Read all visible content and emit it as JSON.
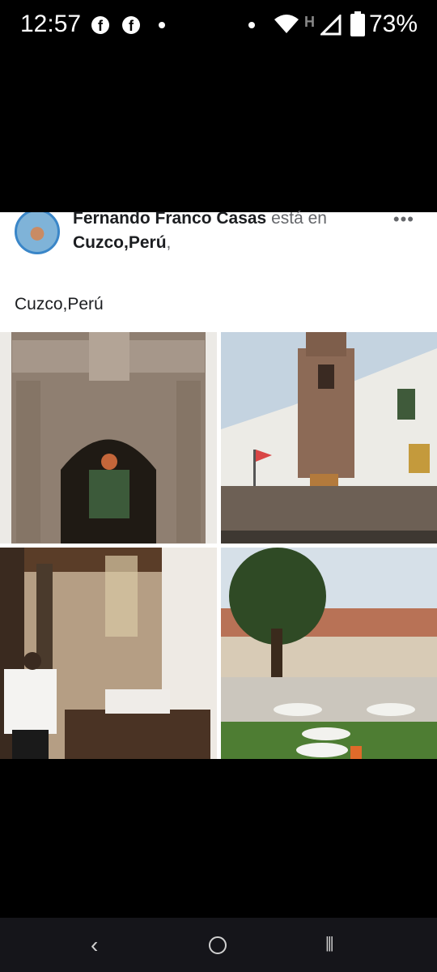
{
  "status_bar": {
    "time": "12:57",
    "battery": "73%",
    "icons": [
      "facebook-icon",
      "facebook-icon",
      "dot",
      "dot",
      "wifi-icon",
      "h-signal-icon",
      "signal-icon",
      "battery-icon"
    ]
  },
  "post": {
    "author": "Fernando Franco Casas",
    "verb": " está en",
    "location": "Cuzco,Perú",
    "privacy": ",",
    "text": "Cuzco,Perú",
    "more_label": "•••"
  },
  "photos": [
    {
      "name": "stone-archway-photo"
    },
    {
      "name": "palacio-building-photo"
    },
    {
      "name": "restaurant-interior-photo"
    },
    {
      "name": "courtyard-garden-photo"
    }
  ],
  "nav": {
    "back": "‹",
    "recents": "⦀"
  }
}
